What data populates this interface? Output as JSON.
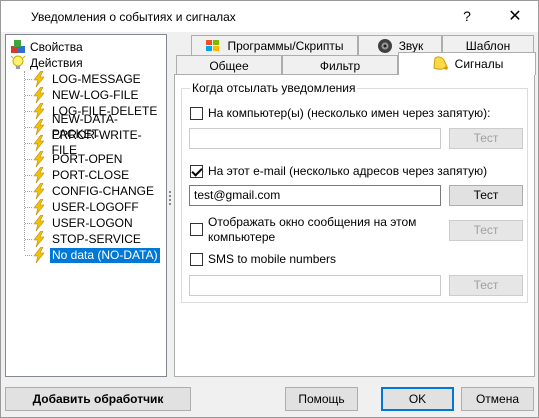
{
  "window": {
    "title": "Уведомления о событиях и сигналах",
    "help_glyph": "?",
    "close_glyph": "✕"
  },
  "tree": {
    "root_properties": "Свойства",
    "root_actions": "Действия",
    "items": [
      "LOG-MESSAGE",
      "NEW-LOG-FILE",
      "LOG-FILE-DELETE",
      "NEW-DATA-PACKET",
      "ERROR-WRITE-FILE",
      "PORT-OPEN",
      "PORT-CLOSE",
      "CONFIG-CHANGE",
      "USER-LOGOFF",
      "USER-LOGON",
      "STOP-SERVICE",
      "No data (NO-DATA)"
    ]
  },
  "tabs": {
    "programs": "Программы/Скрипты",
    "sound": "Звук",
    "template": "Шаблон",
    "general": "Общее",
    "filter": "Фильтр",
    "signals": "Сигналы"
  },
  "signals": {
    "group_title": "Когда отсылать уведомления",
    "computer_label": "На компьютер(ы) (несколько имен через запятую):",
    "computer_value": "",
    "email_label": "На этот e-mail (несколько адресов через запятую)",
    "email_value": "test@gmail.com",
    "popup_label_line1": "Отображать окно сообщения на этом",
    "popup_label_line2": "компьютере",
    "sms_label": "SMS to mobile numbers",
    "sms_value": "",
    "test_label": "Тест"
  },
  "footer": {
    "add_handler": "Добавить обработчик",
    "help": "Помощь",
    "ok": "OK",
    "cancel": "Отмена"
  }
}
